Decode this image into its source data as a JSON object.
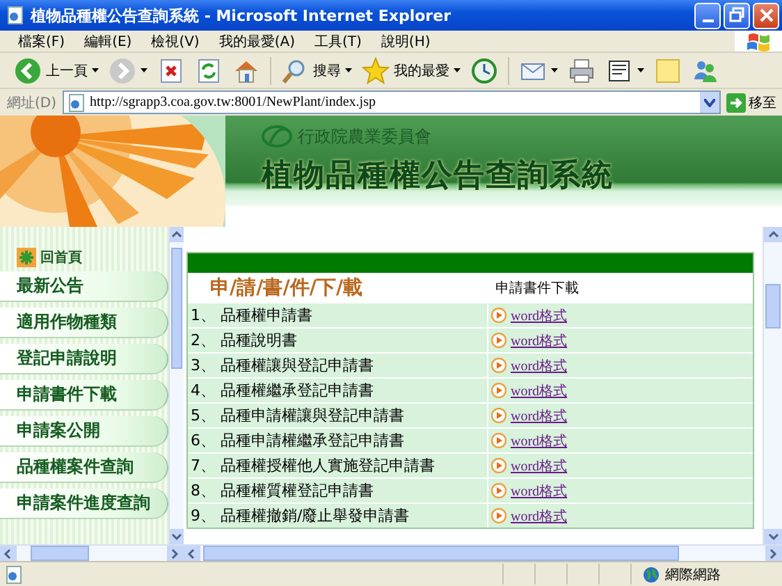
{
  "window": {
    "title": "植物品種權公告查詢系統 - Microsoft Internet Explorer"
  },
  "menu": [
    "檔案(F)",
    "編輯(E)",
    "檢視(V)",
    "我的最愛(A)",
    "工具(T)",
    "說明(H)"
  ],
  "toolbar": [
    {
      "kind": "back",
      "label": "上一頁"
    },
    {
      "kind": "forward"
    },
    {
      "kind": "stop"
    },
    {
      "kind": "refresh"
    },
    {
      "kind": "home"
    },
    {
      "kind": "search",
      "label": "搜尋"
    },
    {
      "kind": "favorites",
      "label": "我的最愛"
    },
    {
      "kind": "history"
    },
    {
      "kind": "mail"
    },
    {
      "kind": "print"
    },
    {
      "kind": "edit"
    },
    {
      "kind": "note"
    },
    {
      "kind": "messenger"
    }
  ],
  "address": {
    "label": "網址(D)",
    "value": "http://sgrapp3.coa.gov.tw:8001/NewPlant/index.jsp",
    "go": "移至"
  },
  "banner": {
    "agency": "行政院農業委員會",
    "title": "植物品種權公告查詢系統"
  },
  "sidebar": {
    "home": "回首頁",
    "items": [
      "最新公告",
      "適用作物種類",
      "登記申請說明",
      "申請書件下載",
      "申請案公開",
      "品種權案件查詢",
      "申請案件進度查詢"
    ]
  },
  "table": {
    "heading": "申/請/書/件/下/載",
    "column_2": "申請書件下載",
    "rows": [
      {
        "number": "1、",
        "name": "品種權申請書",
        "link": "word格式"
      },
      {
        "number": "2、",
        "name": "品種說明書",
        "link": "word格式"
      },
      {
        "number": "3、",
        "name": "品種權讓與登記申請書",
        "link": "word格式"
      },
      {
        "number": "4、",
        "name": "品種權繼承登記申請書",
        "link": "word格式"
      },
      {
        "number": "5、",
        "name": "品種申請權讓與登記申請書",
        "link": "word格式"
      },
      {
        "number": "6、",
        "name": "品種申請權繼承登記申請書",
        "link": "word格式"
      },
      {
        "number": "7、",
        "name": "品種權授權他人實施登記申請書",
        "link": "word格式"
      },
      {
        "number": "8、",
        "name": "品種權質權登記申請書",
        "link": "word格式"
      },
      {
        "number": "9、",
        "name": "品種權撤銷/廢止舉發申請書",
        "link": "word格式"
      }
    ]
  },
  "status_bar": {
    "zone": "網際網路"
  }
}
